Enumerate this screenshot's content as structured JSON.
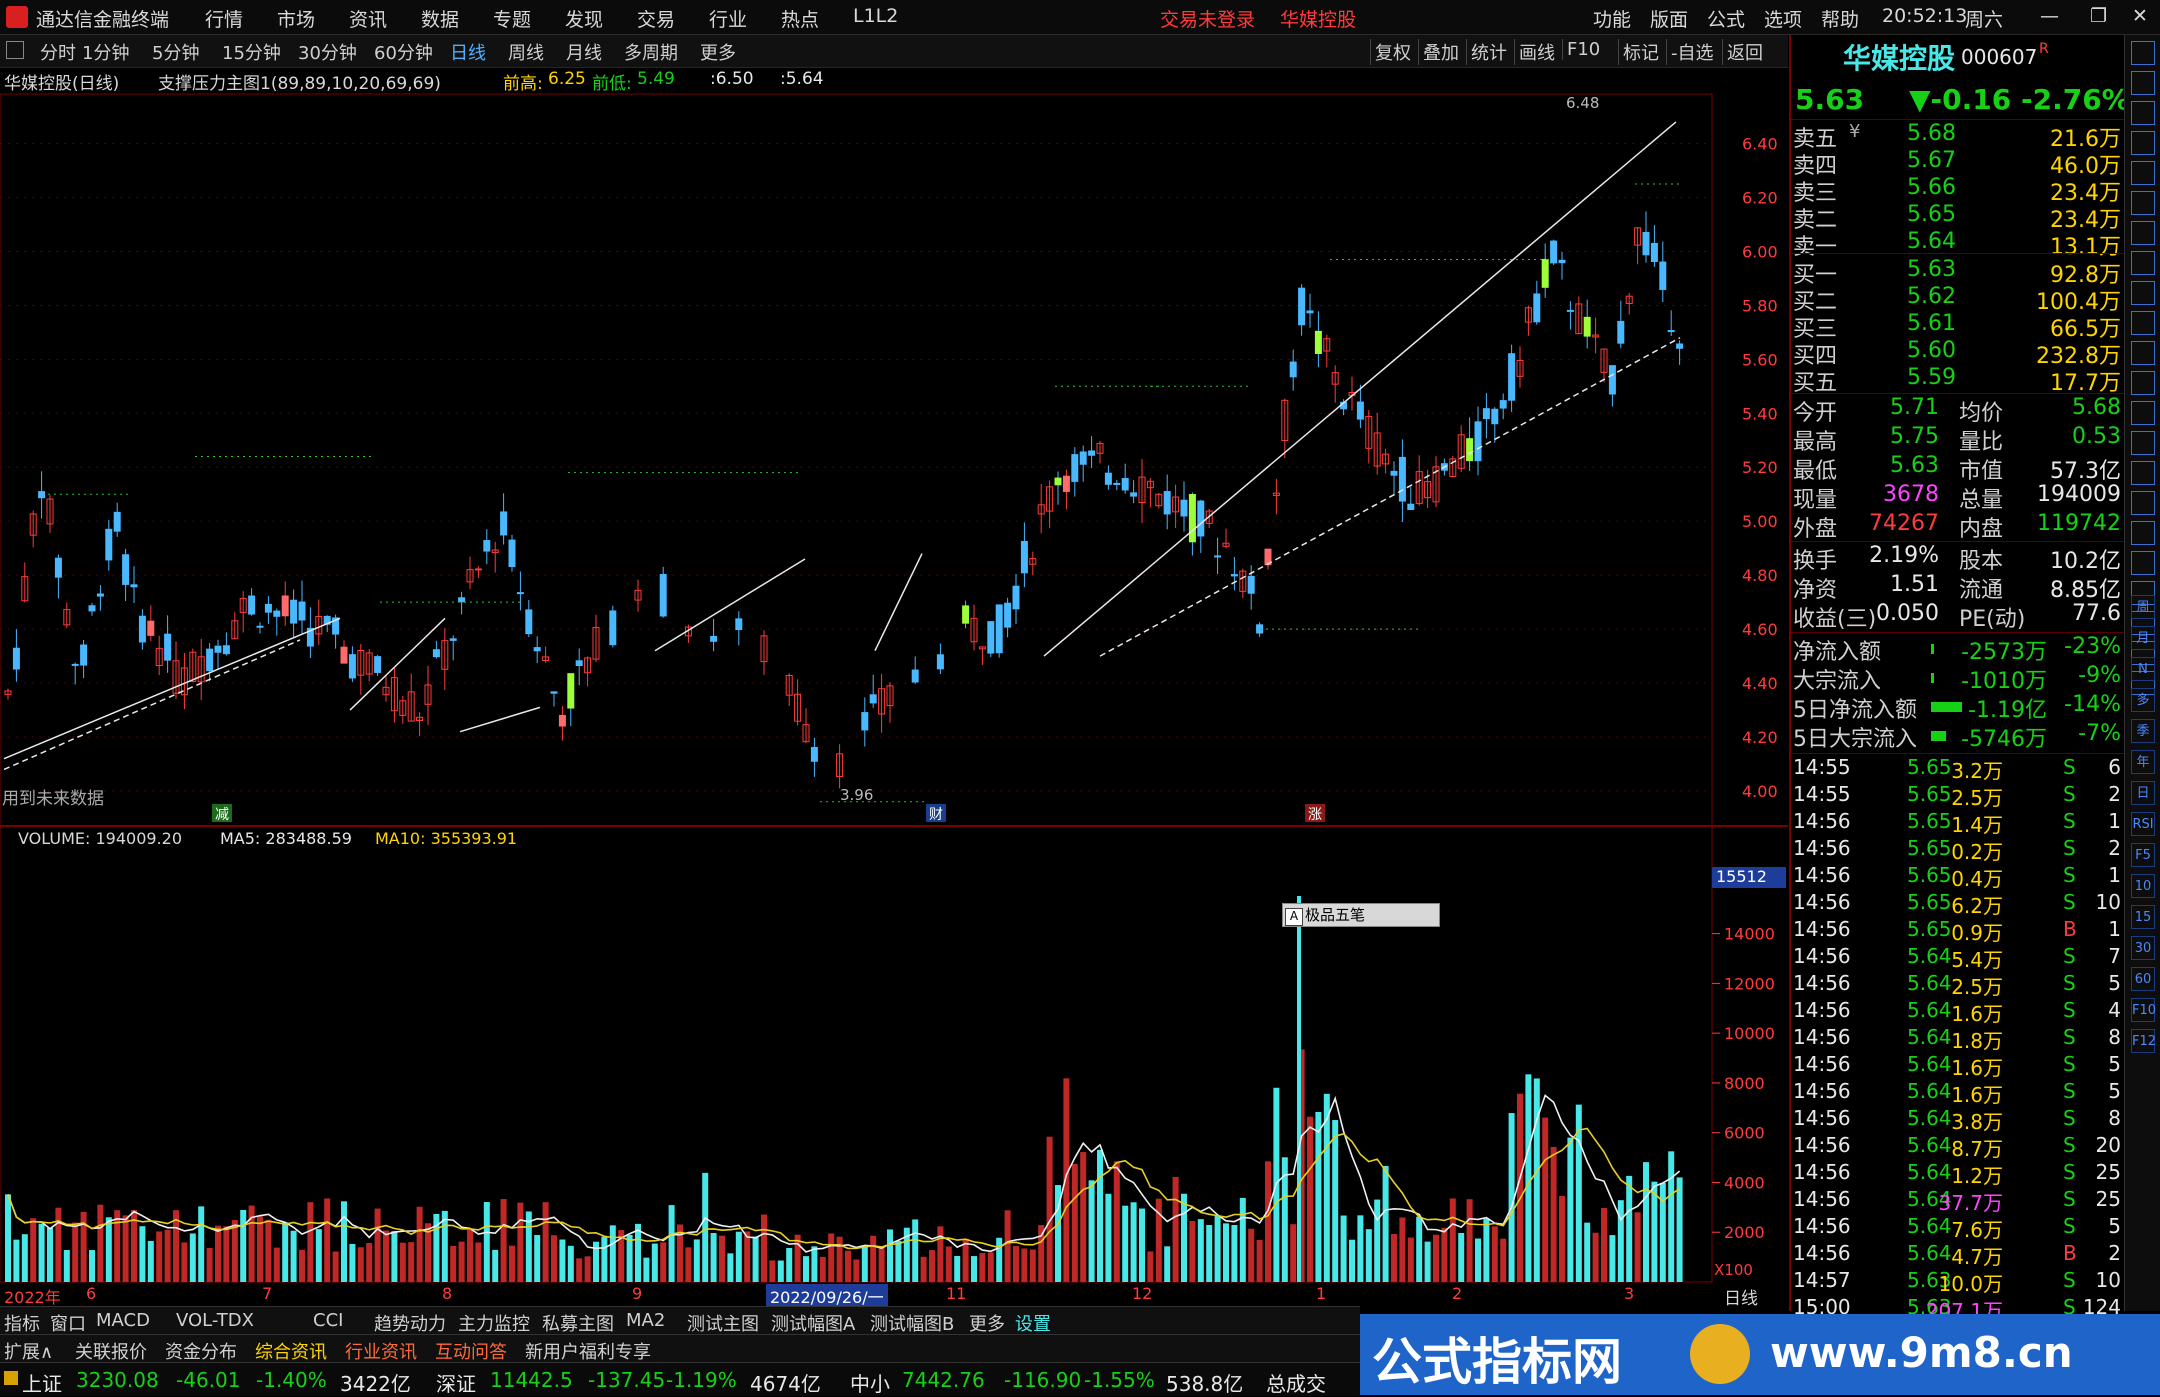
{
  "titlebar": {
    "app_title": "通达信金融终端",
    "menus": [
      "行情",
      "市场",
      "资讯",
      "数据",
      "专题",
      "发现",
      "交易",
      "行业",
      "热点",
      "L1L2"
    ],
    "login_status": "交易未登录",
    "stock_name": "华媒控股",
    "right_menus": [
      "功能",
      "版面",
      "公式",
      "选项",
      "帮助"
    ],
    "time": "20:52:13",
    "weekday": "周六"
  },
  "periodbar": {
    "periods": [
      "分时",
      "1分钟",
      "5分钟",
      "15分钟",
      "30分钟",
      "60分钟",
      "日线",
      "周线",
      "月线",
      "多周期",
      "更多"
    ],
    "active": "日线",
    "tools": [
      "复权",
      "叠加",
      "统计",
      "画线",
      "F10",
      "标记",
      "-自选",
      "返回"
    ]
  },
  "chart": {
    "header_left": "华媒控股(日线)",
    "formula": "支撑压力主图1(89,89,10,20,69,69)",
    "prev_high_label": "前高:",
    "prev_high": "6.25",
    "prev_low_label": "前低:",
    "prev_low": "5.49",
    "v1": ":6.50",
    "v2": ":5.64",
    "future_note": "用到未来数据",
    "label_high": "6.48",
    "label_low": "3.96",
    "markers": [
      "减",
      "财",
      "涨"
    ],
    "yaxis": [
      "6.40",
      "6.20",
      "6.00",
      "5.80",
      "5.60",
      "5.40",
      "5.20",
      "5.00",
      "4.80",
      "4.60",
      "4.40",
      "4.20",
      "4.00"
    ],
    "volume_header": "VOLUME: 194009.20",
    "ma5": "MA5: 283488.59",
    "ma10": "MA10: 355393.91",
    "vol_tag": "15512",
    "vol_yaxis": [
      "14000",
      "12000",
      "10000",
      "8000",
      "6000",
      "4000",
      "2000"
    ],
    "vol_unit": "X100",
    "xaxis": [
      "2022年",
      "6",
      "7",
      "8",
      "9",
      "2022/09/26/一",
      "11",
      "12",
      "1",
      "2",
      "3"
    ],
    "xaxis_right": "日线",
    "ime_label": "极品五笔"
  },
  "chart_data": {
    "type": "candlestick",
    "title": "华媒控股(日线)",
    "ylim": [
      3.9,
      6.55
    ],
    "yticks": [
      4.0,
      4.2,
      4.4,
      4.6,
      4.8,
      5.0,
      5.2,
      5.4,
      5.6,
      5.8,
      6.0,
      6.2,
      6.4
    ],
    "volume_ylim": [
      0,
      15512
    ],
    "volume_yticks": [
      2000,
      4000,
      6000,
      8000,
      10000,
      12000,
      14000
    ],
    "x_labels": [
      "2022年",
      "6",
      "7",
      "8",
      "9",
      "2022/09/26/一",
      "11",
      "12",
      "1",
      "2",
      "3"
    ],
    "annotated_high": 6.48,
    "annotated_low": 3.96,
    "last_close": 5.63,
    "last_volume": 194009.2,
    "ma5_volume": 283488.59,
    "ma10_volume": 355393.91
  },
  "quote": {
    "name": "华媒控股",
    "code": "000607",
    "flag": "R",
    "price": "5.63",
    "change": "▼-0.16",
    "pct": "-2.76%",
    "asks": [
      {
        "label": "卖五",
        "price": "5.68",
        "vol": "21.6万"
      },
      {
        "label": "卖四",
        "price": "5.67",
        "vol": "46.0万"
      },
      {
        "label": "卖三",
        "price": "5.66",
        "vol": "23.4万"
      },
      {
        "label": "卖二",
        "price": "5.65",
        "vol": "23.4万"
      },
      {
        "label": "卖一",
        "price": "5.64",
        "vol": "13.1万"
      }
    ],
    "ask_currency": "¥",
    "bids": [
      {
        "label": "买一",
        "price": "5.63",
        "vol": "92.8万"
      },
      {
        "label": "买二",
        "price": "5.62",
        "vol": "100.4万"
      },
      {
        "label": "买三",
        "price": "5.61",
        "vol": "66.5万"
      },
      {
        "label": "买四",
        "price": "5.60",
        "vol": "232.8万"
      },
      {
        "label": "买五",
        "price": "5.59",
        "vol": "17.7万"
      }
    ],
    "stats": [
      {
        "l": "今开",
        "v": "5.71",
        "l2": "均价",
        "v2": "5.68"
      },
      {
        "l": "最高",
        "v": "5.75",
        "l2": "量比",
        "v2": "0.53"
      },
      {
        "l": "最低",
        "v": "5.63",
        "l2": "市值",
        "v2": "57.3亿"
      },
      {
        "l": "现量",
        "v": "3678",
        "l2": "总量",
        "v2": "194009"
      },
      {
        "l": "外盘",
        "v": "74267",
        "l2": "内盘",
        "v2": "119742"
      }
    ],
    "fin": [
      {
        "l": "换手",
        "v": "2.19%",
        "l2": "股本",
        "v2": "10.2亿"
      },
      {
        "l": "净资",
        "v": "1.51",
        "l2": "流通",
        "v2": "8.85亿"
      },
      {
        "l": "收益(三)",
        "v": "0.050",
        "l2": "PE(动)",
        "v2": "77.6"
      }
    ],
    "flows": [
      {
        "l": "净流入额",
        "v": "-2573万",
        "p": "-23%",
        "bar": 0.05
      },
      {
        "l": "大宗流入",
        "v": "-1010万",
        "p": "-9%",
        "bar": 0.02
      },
      {
        "l": "5日净流入额",
        "v": "-1.19亿",
        "p": "-14%",
        "bar": 0.9
      },
      {
        "l": "5日大宗流入",
        "v": "-5746万",
        "p": "-7%",
        "bar": 0.45
      }
    ],
    "ticks": [
      [
        "14:55",
        "5.65",
        "3.2万",
        "S",
        "6"
      ],
      [
        "14:55",
        "5.65",
        "2.5万",
        "S",
        "2"
      ],
      [
        "14:56",
        "5.65",
        "1.4万",
        "S",
        "1"
      ],
      [
        "14:56",
        "5.65",
        "0.2万",
        "S",
        "2"
      ],
      [
        "14:56",
        "5.65",
        "0.4万",
        "S",
        "1"
      ],
      [
        "14:56",
        "5.65",
        "6.2万",
        "S",
        "10"
      ],
      [
        "14:56",
        "5.65",
        "0.9万",
        "B",
        "1"
      ],
      [
        "14:56",
        "5.64",
        "5.4万",
        "S",
        "7"
      ],
      [
        "14:56",
        "5.64",
        "2.5万",
        "S",
        "5"
      ],
      [
        "14:56",
        "5.64",
        "1.6万",
        "S",
        "4"
      ],
      [
        "14:56",
        "5.64",
        "1.8万",
        "S",
        "8"
      ],
      [
        "14:56",
        "5.64",
        "1.6万",
        "S",
        "5"
      ],
      [
        "14:56",
        "5.64",
        "1.6万",
        "S",
        "5"
      ],
      [
        "14:56",
        "5.64",
        "3.8万",
        "S",
        "8"
      ],
      [
        "14:56",
        "5.64",
        "8.7万",
        "S",
        "20"
      ],
      [
        "14:56",
        "5.64",
        "1.2万",
        "S",
        "25"
      ],
      [
        "14:56",
        "5.64",
        "37.7万",
        "S",
        "25"
      ],
      [
        "14:56",
        "5.64",
        "7.6万",
        "S",
        "5"
      ],
      [
        "14:56",
        "5.64",
        "4.7万",
        "B",
        "2"
      ],
      [
        "14:57",
        "5.63",
        "10.0万",
        "S",
        "10"
      ],
      [
        "15:00",
        "5.63",
        "207.1万",
        "S",
        "124"
      ]
    ]
  },
  "sideicons": [
    "周",
    "月",
    "N",
    "多",
    "季",
    "年",
    "日",
    "RSI",
    "F5",
    "10",
    "15",
    "30",
    "60",
    "F10",
    "F12"
  ],
  "tabs": [
    "指标",
    "窗口",
    "MACD",
    "VOL-TDX",
    "CCI",
    "趋势动力",
    "主力监控",
    "私募主图",
    "MA2",
    "测试主图",
    "测试幅图A",
    "测试幅图B",
    "更多",
    "设置"
  ],
  "tabs2": [
    "扩展∧",
    "关联报价",
    "资金分布",
    "综合资讯",
    "行业资讯",
    "互动问答",
    "新用户福利专享"
  ],
  "status": {
    "sh_name": "上证",
    "sh_val": "3230.08",
    "sh_chg": "-46.01",
    "sh_pct": "-1.40%",
    "sh_amt": "3422亿",
    "sz_name": "深证",
    "sz_val": "11442.5",
    "sz_chg": "-137.45",
    "sz_pct": "-1.19%",
    "sz_amt": "4674亿",
    "zx_name": "中小",
    "zx_val": "7442.76",
    "zx_chg": "-116.90",
    "zx_pct": "-1.55%",
    "zx_amt": "538.8亿",
    "total_label": "总成交"
  },
  "banner": {
    "text": "公式指标网",
    "url": "www.9m8.cn"
  }
}
